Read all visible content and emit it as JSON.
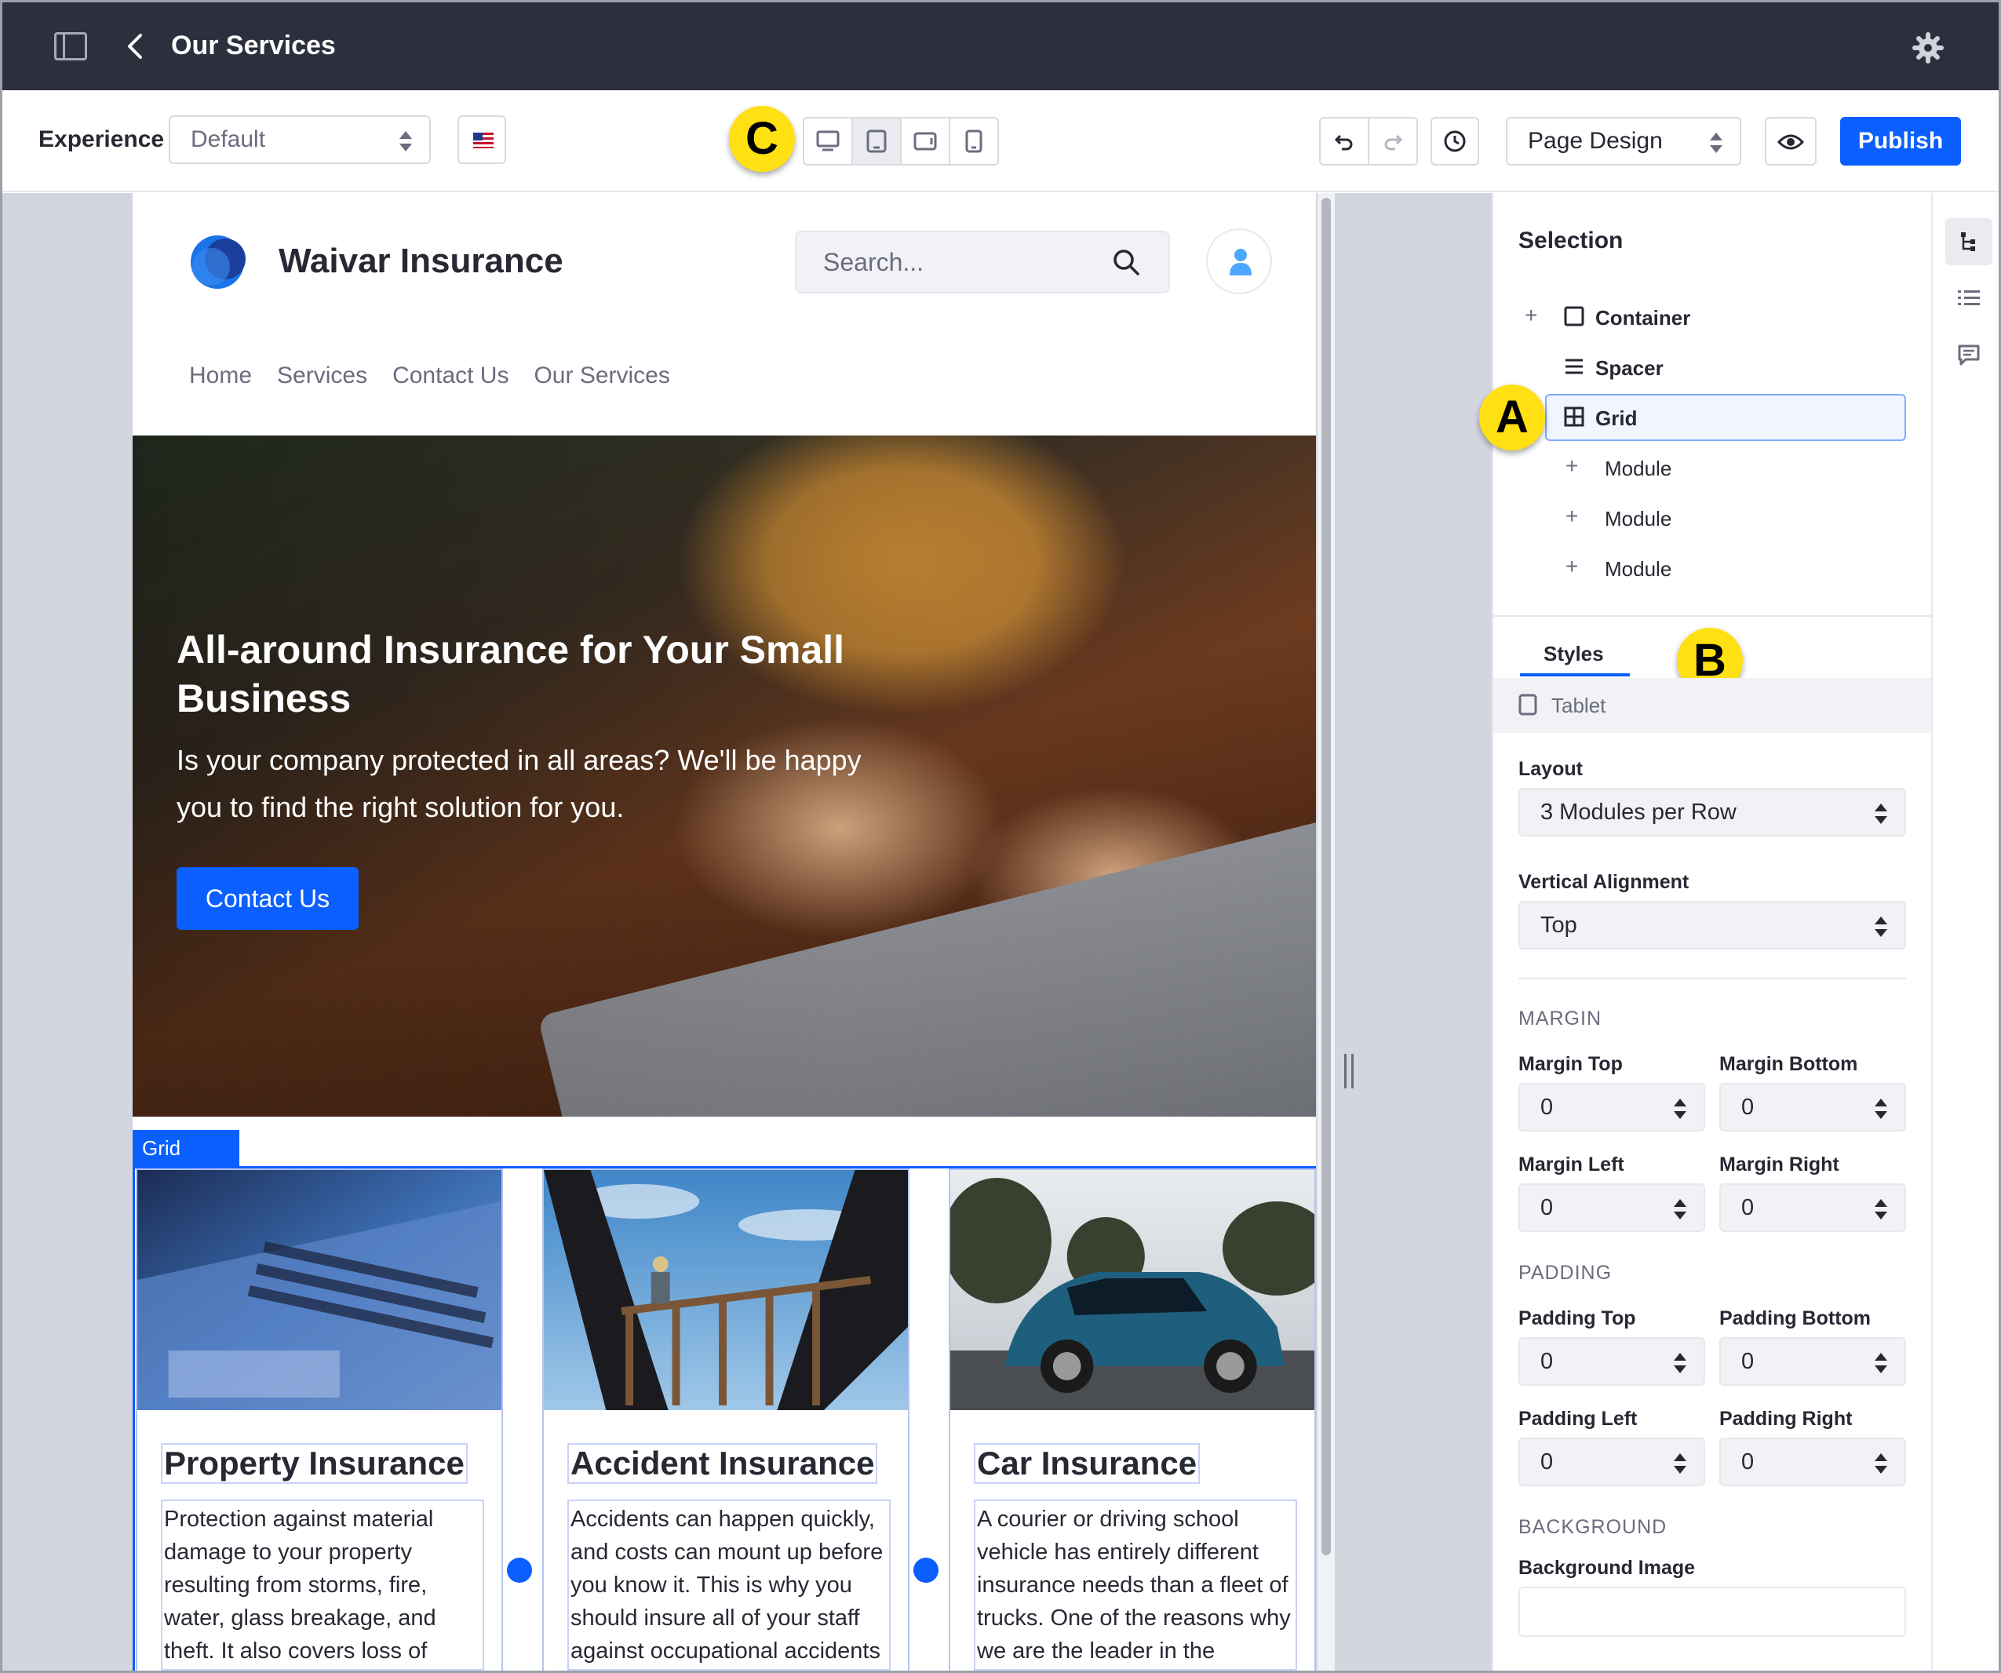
{
  "header": {
    "page_title": "Our Services"
  },
  "toolbar": {
    "experience_label": "Experience",
    "experience_value": "Default",
    "view_select": "Page Design",
    "publish_label": "Publish"
  },
  "markers": {
    "a": "A",
    "b": "B",
    "c": "C"
  },
  "site": {
    "brand": "Waivar Insurance",
    "search_placeholder": "Search...",
    "nav": [
      "Home",
      "Services",
      "Contact Us",
      "Our Services"
    ],
    "hero": {
      "title": "All-around Insurance for Your Small Business",
      "subtitle": "Is your company protected in all areas? We'll be happy you to find the right solution for you.",
      "cta": "Contact Us"
    },
    "grid_tag": "Grid",
    "cards": [
      {
        "title": "Property Insurance",
        "text": "Protection against material damage to your property resulting from storms, fire, water, glass breakage, and theft. It also covers loss of"
      },
      {
        "title": "Accident Insurance",
        "text": "Accidents can happen quickly, and costs can mount up before you know it. This is why you should insure all of your staff against occupational accidents"
      },
      {
        "title": "Car Insurance",
        "text": "A courier or driving school vehicle has entirely different insurance needs than a fleet of trucks. One of the reasons why we are the leader in the"
      }
    ]
  },
  "panel": {
    "title": "Selection",
    "tree": [
      "Container",
      "Spacer",
      "Grid",
      "Module",
      "Module",
      "Module"
    ],
    "tab_styles": "Styles",
    "device": "Tablet",
    "layout_label": "Layout",
    "layout_value": "3 Modules per Row",
    "valign_label": "Vertical Alignment",
    "valign_value": "Top",
    "margin_section": "MARGIN",
    "margin_top_label": "Margin Top",
    "margin_bottom_label": "Margin Bottom",
    "margin_left_label": "Margin Left",
    "margin_right_label": "Margin Right",
    "padding_section": "PADDING",
    "padding_top_label": "Padding Top",
    "padding_bottom_label": "Padding Bottom",
    "padding_left_label": "Padding Left",
    "padding_right_label": "Padding Right",
    "background_section": "BACKGROUND",
    "background_image_label": "Background Image",
    "zero": "0"
  },
  "colors": {
    "accent": "#0b5fff",
    "topbar": "#2c2f3c",
    "marker": "#ffe013"
  }
}
